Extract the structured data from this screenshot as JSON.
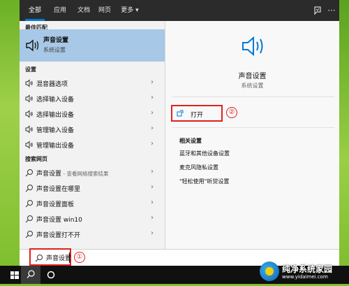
{
  "tabs": [
    "全部",
    "应用",
    "文档",
    "网页",
    "更多 ▾"
  ],
  "icons": {
    "feedback": "feedback-icon",
    "more": "ellipsis-icon"
  },
  "left": {
    "best_match_header": "最佳匹配",
    "best_match": {
      "title": "声音设置",
      "subtitle": "系统设置"
    },
    "settings_header": "设置",
    "settings": [
      "混音器选项",
      "选择输入设备",
      "选择输出设备",
      "管理输入设备",
      "管理输出设备"
    ],
    "web_header": "搜索网页",
    "web": [
      {
        "main": "声音设置",
        "suffix": " - 查看网络搜索结果"
      },
      {
        "main": "声音设置在哪里",
        "suffix": ""
      },
      {
        "main": "声音设置面板",
        "suffix": ""
      },
      {
        "main": "声音设置 win10",
        "suffix": ""
      },
      {
        "main": "声音设置打不开",
        "suffix": ""
      }
    ]
  },
  "right": {
    "title": "声音设置",
    "subtitle": "系统设置",
    "open_label": "打开",
    "annotation_2": "②",
    "related_header": "相关设置",
    "related": [
      "蓝牙和其他设备设置",
      "麦克风隐私设置",
      "\"轻松使用\"听觉设置"
    ]
  },
  "search": {
    "value": "声音设置",
    "annotation_1": "①"
  },
  "watermark": {
    "title": "纯净系统家园",
    "url": "www.yidaimei.com"
  },
  "colors": {
    "accent": "#0078d7",
    "selected": "#a7c8e6",
    "annotation": "#e02020",
    "topbar": "#2b2b2b"
  }
}
